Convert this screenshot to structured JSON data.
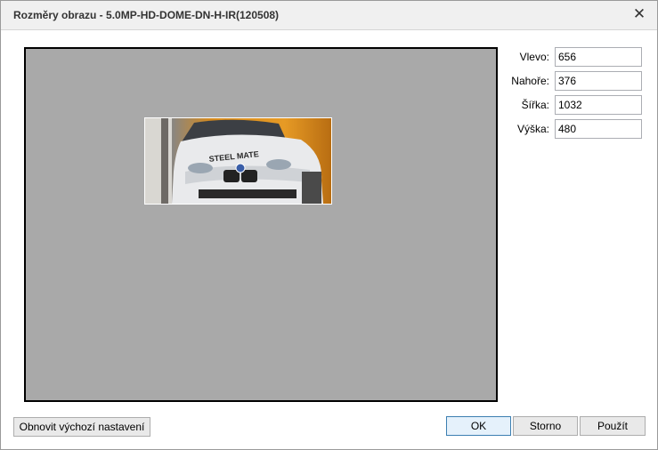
{
  "window": {
    "title": "Rozměry obrazu - 5.0MP-HD-DOME-DN-H-IR(120508)",
    "close_icon": "close-icon"
  },
  "preview": {
    "background": "#a9a9a9",
    "overlay_text": "STEEL MATE"
  },
  "fields": [
    {
      "label": "Vlevo:",
      "value": "656"
    },
    {
      "label": "Nahoře:",
      "value": "376"
    },
    {
      "label": "Šířka:",
      "value": "1032"
    },
    {
      "label": "Výška:",
      "value": "480"
    }
  ],
  "buttons": {
    "reset": "Obnovit výchozí nastavení",
    "ok": "OK",
    "cancel": "Storno",
    "apply": "Použít"
  }
}
